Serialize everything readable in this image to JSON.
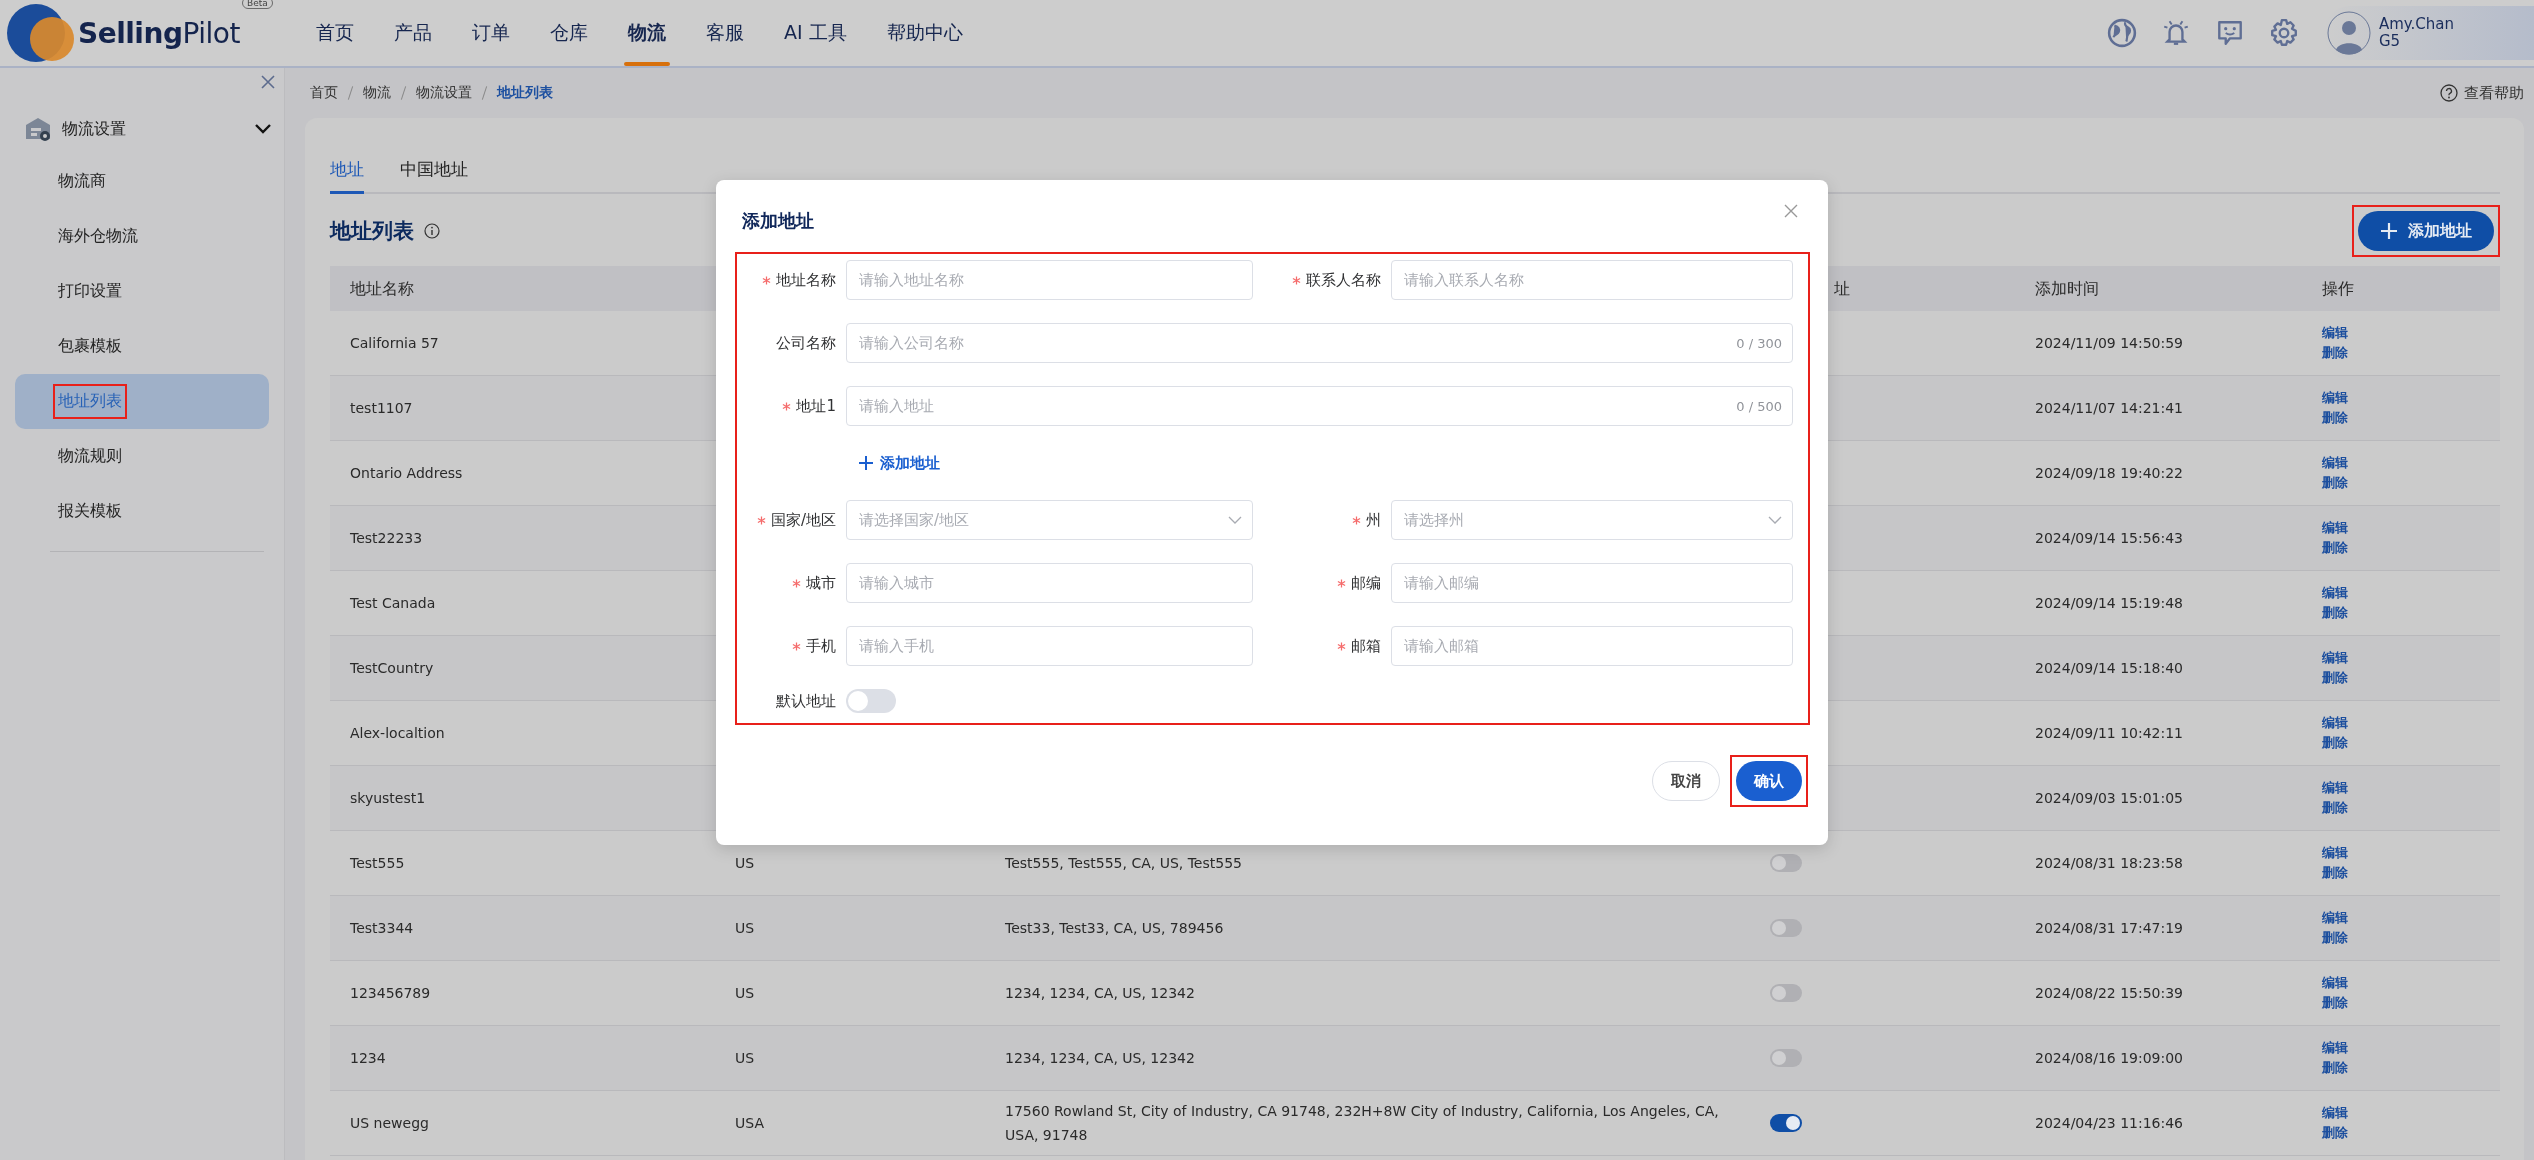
{
  "header": {
    "logo_text": "**Selling**Pilot",
    "logo_badge": "Beta",
    "nav": [
      {
        "label": "首页",
        "selected": false
      },
      {
        "label": "产品",
        "selected": false
      },
      {
        "label": "订单",
        "selected": false
      },
      {
        "label": "仓库",
        "selected": false
      },
      {
        "label": "物流",
        "selected": true
      },
      {
        "label": "客服",
        "selected": false
      },
      {
        "label": "AI 工具",
        "selected": false
      },
      {
        "label": "帮助中心",
        "selected": false
      }
    ],
    "user": {
      "name": "Amy.Chan",
      "grade": "G5"
    }
  },
  "sidebar": {
    "group": {
      "label": "物流设置",
      "expanded": true
    },
    "items": [
      {
        "label": "物流商",
        "selected": false,
        "highlighted": false
      },
      {
        "label": "海外仓物流",
        "selected": false,
        "highlighted": false
      },
      {
        "label": "打印设置",
        "selected": false,
        "highlighted": false
      },
      {
        "label": "包裹模板",
        "selected": false,
        "highlighted": false
      },
      {
        "label": "地址列表",
        "selected": true,
        "highlighted": true
      },
      {
        "label": "物流规则",
        "selected": false,
        "highlighted": false
      },
      {
        "label": "报关模板",
        "selected": false,
        "highlighted": false
      }
    ]
  },
  "breadcrumb": [
    {
      "label": "首页",
      "selected": false
    },
    {
      "label": "物流",
      "selected": false
    },
    {
      "label": "物流设置",
      "selected": false
    },
    {
      "label": "地址列表",
      "selected": true
    }
  ],
  "help_link": "查看帮助",
  "tabs": [
    {
      "label": "地址",
      "selected": true
    },
    {
      "label": "中国地址",
      "selected": false
    }
  ],
  "list_title": "地址列表",
  "add_button": {
    "label": "添加地址",
    "highlighted": true
  },
  "table": {
    "columns": {
      "column_1": "地址名称",
      "column_4": "址",
      "column_5": "添加时间",
      "column_6": "操作"
    },
    "rows": [
      {
        "name": "California 57",
        "added": "2024/11/09 14:50:59",
        "actions": [
          "编辑",
          "删除"
        ]
      },
      {
        "name": "test1107",
        "added": "2024/11/07 14:21:41",
        "actions": [
          "编辑",
          "删除"
        ]
      },
      {
        "name": "Ontario Address",
        "added": "2024/09/18 19:40:22",
        "actions": [
          "编辑",
          "删除"
        ]
      },
      {
        "name": "Test22233",
        "added": "2024/09/14 15:56:43",
        "actions": [
          "编辑",
          "删除"
        ]
      },
      {
        "name": "Test Canada",
        "added": "2024/09/14 15:19:48",
        "actions": [
          "编辑",
          "删除"
        ]
      },
      {
        "name": "TestCountry",
        "added": "2024/09/14 15:18:40",
        "actions": [
          "编辑",
          "删除"
        ]
      },
      {
        "name": "Alex-localtion",
        "added": "2024/09/11 10:42:11",
        "actions": [
          "编辑",
          "删除"
        ]
      },
      {
        "name": "skyustest1",
        "added": "2024/09/03 15:01:05",
        "actions": [
          "编辑",
          "删除"
        ]
      },
      {
        "name": "Test555",
        "country": "US",
        "address": "Test555, Test555, CA, US, Test555",
        "default": false,
        "added": "2024/08/31 18:23:58",
        "actions": [
          "编辑",
          "删除"
        ]
      },
      {
        "name": "Test3344",
        "country": "US",
        "address": "Test33, Test33, CA, US, 789456",
        "default": false,
        "added": "2024/08/31 17:47:19",
        "actions": [
          "编辑",
          "删除"
        ]
      },
      {
        "name": "123456789",
        "country": "US",
        "address": "1234, 1234, CA, US, 12342",
        "default": false,
        "added": "2024/08/22 15:50:39",
        "actions": [
          "编辑",
          "删除"
        ]
      },
      {
        "name": "1234",
        "country": "US",
        "address": "1234, 1234, CA, US, 12342",
        "default": false,
        "added": "2024/08/16 19:09:00",
        "actions": [
          "编辑",
          "删除"
        ]
      },
      {
        "name": "US newegg",
        "country": "USA",
        "address": "17560 Rowland St, City of Industry, CA 91748, 232H+8W City of Industry, California, Los Angeles, CA, USA, 91748",
        "default": true,
        "added": "2024/04/23 11:16:46",
        "actions": [
          "编辑",
          "删除"
        ]
      }
    ]
  },
  "dialog": {
    "title": "添加地址",
    "form_highlighted": true,
    "rows": [
      {
        "kind": "fields",
        "fields": [
          {
            "label": "地址名称",
            "required": true,
            "kind": "text",
            "placeholder": "请输入地址名称"
          },
          {
            "label": "联系人名称",
            "required": true,
            "kind": "text",
            "placeholder": "请输入联系人名称"
          }
        ]
      },
      {
        "kind": "fields",
        "fields": [
          {
            "label": "公司名称",
            "required": false,
            "kind": "text",
            "placeholder": "请输入公司名称",
            "counter": "0 / 300"
          }
        ]
      },
      {
        "kind": "fields",
        "fields": [
          {
            "label": "地址1",
            "required": true,
            "kind": "text",
            "placeholder": "请输入地址",
            "counter": "0 / 500"
          }
        ]
      },
      {
        "kind": "link",
        "label": "添加地址"
      },
      {
        "kind": "fields",
        "fields": [
          {
            "label": "国家/地区",
            "required": true,
            "kind": "select",
            "placeholder": "请选择国家/地区"
          },
          {
            "label": "州",
            "required": true,
            "kind": "select",
            "placeholder": "请选择州"
          }
        ]
      },
      {
        "kind": "fields",
        "fields": [
          {
            "label": "城市",
            "required": true,
            "kind": "text",
            "placeholder": "请输入城市"
          },
          {
            "label": "邮编",
            "required": true,
            "kind": "text",
            "placeholder": "请输入邮编"
          }
        ]
      },
      {
        "kind": "fields",
        "fields": [
          {
            "label": "手机",
            "required": true,
            "kind": "text",
            "placeholder": "请输入手机"
          },
          {
            "label": "邮箱",
            "required": true,
            "kind": "text",
            "placeholder": "请输入邮箱"
          }
        ]
      },
      {
        "kind": "toggle",
        "label": "默认地址",
        "on": false
      }
    ],
    "buttons": [
      {
        "label": "取消",
        "kind": "secondary",
        "highlighted": false
      },
      {
        "label": "确认",
        "kind": "primary",
        "highlighted": true
      }
    ]
  }
}
